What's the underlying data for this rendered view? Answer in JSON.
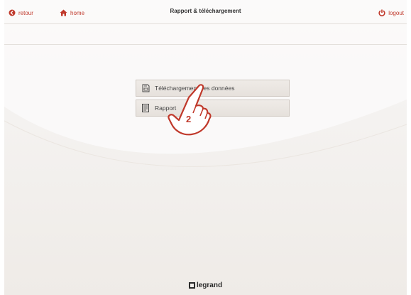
{
  "header": {
    "back_label": "retour",
    "home_label": "home",
    "title": "Rapport & téléchargement",
    "logout_label": "logout"
  },
  "menu": {
    "items": [
      {
        "label": "Téléchargement des données",
        "icon": "sd-card-icon"
      },
      {
        "label": "Rapport",
        "icon": "document-icon"
      }
    ]
  },
  "annotation": {
    "step_number": "2",
    "icon": "pointing-hand-icon"
  },
  "footer": {
    "brand": "legrand"
  },
  "colors": {
    "accent": "#c0392b",
    "background": "#f4f2f0",
    "button": "#e9e5e1"
  }
}
